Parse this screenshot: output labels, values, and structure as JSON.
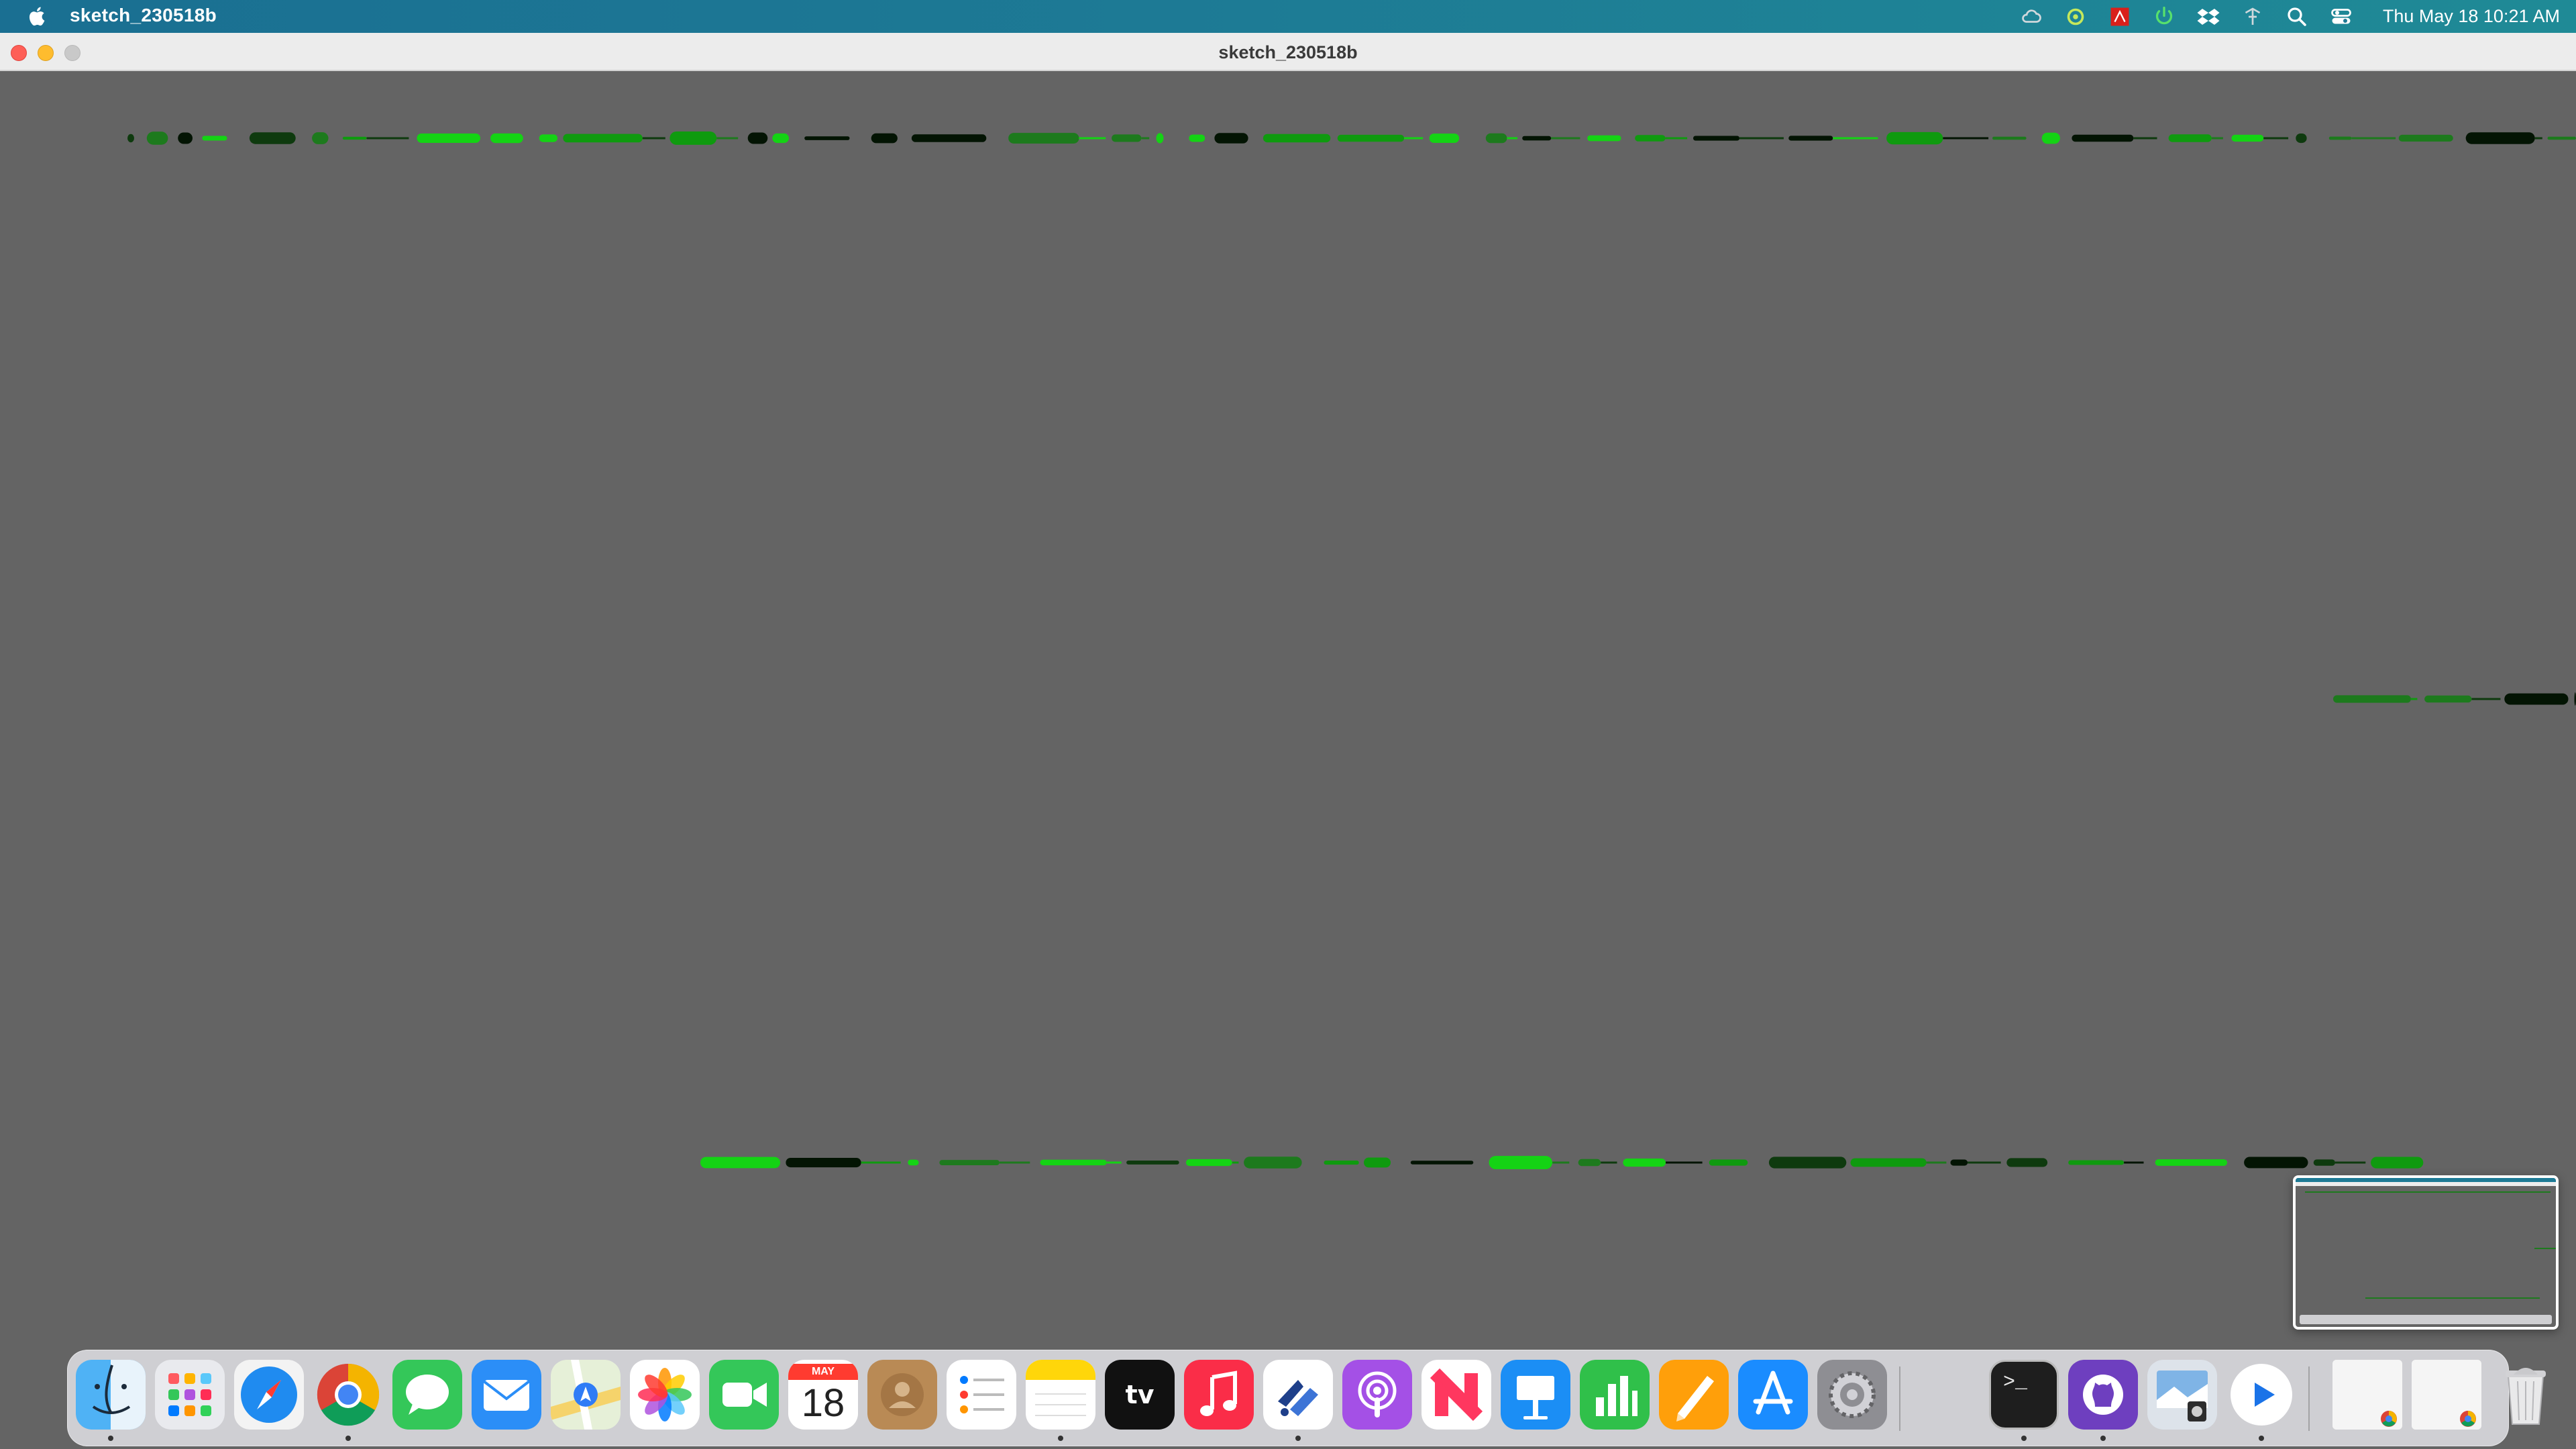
{
  "menubar": {
    "app_name": "sketch_230518b",
    "status_icons": [
      "creative-cloud-icon",
      "sync-icon",
      "acrobat-icon",
      "power-icon",
      "dropbox-icon",
      "network-icon",
      "spotlight-icon",
      "control-center-icon"
    ],
    "clock": "Thu May 18  10:21 AM"
  },
  "window": {
    "title": "sketch_230518b"
  },
  "canvas": {
    "background": "#646464",
    "stroke_colors": [
      "#0f9a0f",
      "#14d314",
      "#1d7a1d",
      "#0e3a0e",
      "#031403"
    ]
  },
  "dock": {
    "items": [
      {
        "name": "finder",
        "running": true
      },
      {
        "name": "launchpad",
        "running": false
      },
      {
        "name": "safari",
        "running": false
      },
      {
        "name": "chrome",
        "running": true
      },
      {
        "name": "messages",
        "running": false
      },
      {
        "name": "mail",
        "running": false
      },
      {
        "name": "maps",
        "running": false
      },
      {
        "name": "photos",
        "running": false
      },
      {
        "name": "facetime",
        "running": false
      },
      {
        "name": "calendar",
        "running": false
      },
      {
        "name": "contacts",
        "running": false
      },
      {
        "name": "reminders",
        "running": false
      },
      {
        "name": "notes",
        "running": true
      },
      {
        "name": "apple-tv",
        "running": false
      },
      {
        "name": "music",
        "running": false
      },
      {
        "name": "processing",
        "running": true
      },
      {
        "name": "podcasts",
        "running": false
      },
      {
        "name": "news",
        "running": false
      },
      {
        "name": "keynote",
        "running": false
      },
      {
        "name": "numbers",
        "running": false
      },
      {
        "name": "pages",
        "running": false
      },
      {
        "name": "app-store",
        "running": false
      },
      {
        "name": "system-settings",
        "running": false
      },
      {
        "name": "terminal",
        "running": true
      },
      {
        "name": "github-desktop",
        "running": true
      },
      {
        "name": "preview",
        "running": false
      },
      {
        "name": "quicktime",
        "running": true
      },
      {
        "name": "chrome-window-1",
        "running": false
      },
      {
        "name": "chrome-window-2",
        "running": false
      },
      {
        "name": "trash",
        "running": false
      }
    ],
    "calendar_month": "MAY",
    "calendar_day": "18",
    "tv_label": "tv",
    "terminal_label": ">_"
  }
}
